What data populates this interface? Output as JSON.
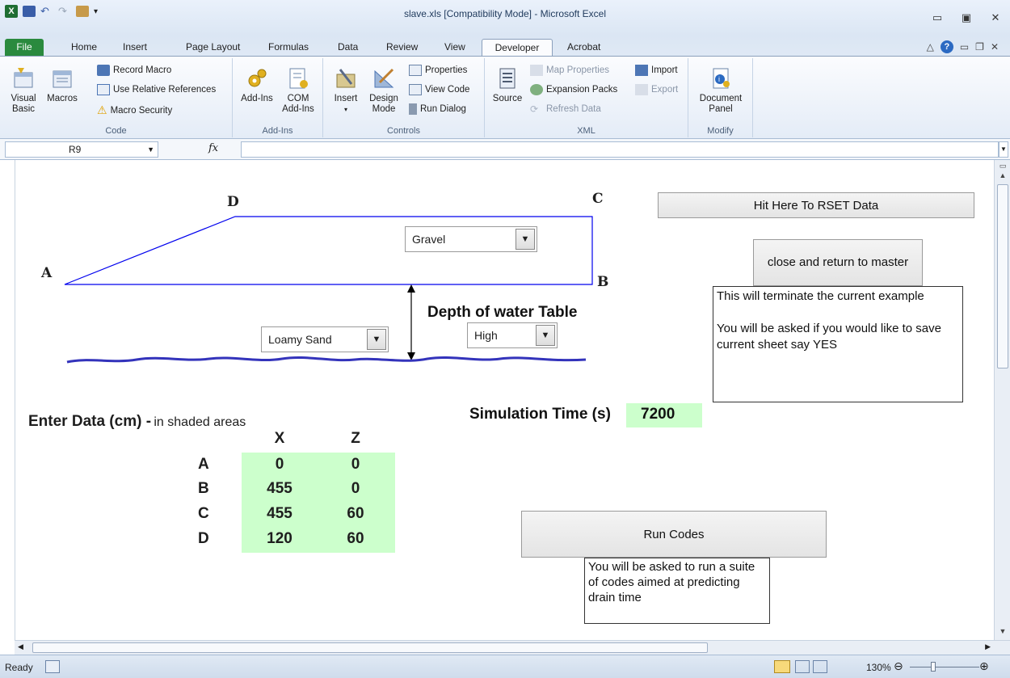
{
  "window": {
    "title": "slave.xls  [Compatibility Mode]  -  Microsoft Excel"
  },
  "tabs": [
    "File",
    "Home",
    "Insert",
    "Page Layout",
    "Formulas",
    "Data",
    "Review",
    "View",
    "Developer",
    "Acrobat"
  ],
  "ribbon": {
    "code": {
      "label": "Code",
      "visual_basic": "Visual Basic",
      "macros": "Macros",
      "record_macro": "Record Macro",
      "use_relative": "Use Relative References",
      "macro_security": "Macro Security"
    },
    "addins": {
      "label": "Add-Ins",
      "addins": "Add-Ins",
      "com_addins": "COM Add-Ins"
    },
    "controls": {
      "label": "Controls",
      "insert": "Insert",
      "design_mode": "Design Mode",
      "properties": "Properties",
      "view_code": "View Code",
      "run_dialog": "Run Dialog"
    },
    "xml": {
      "label": "XML",
      "source": "Source",
      "map_properties": "Map Properties",
      "expansion_packs": "Expansion Packs",
      "refresh_data": "Refresh Data",
      "import": "Import",
      "export": "Export"
    },
    "modify": {
      "label": "Modify",
      "document_panel": "Document Panel"
    }
  },
  "formula_bar": {
    "name_box": "R9",
    "fx": "fx",
    "formula": ""
  },
  "sheet": {
    "point_labels": {
      "A": "A",
      "B": "B",
      "C": "C",
      "D": "D"
    },
    "combo_gravel": "Gravel",
    "combo_loamy_sand": "Loamy Sand",
    "combo_water_level": "High",
    "depth_label": "Depth of water Table",
    "reset_button": "Hit Here To RSET Data",
    "close_button": "close and return to master",
    "close_note_1": "This will terminate the current example",
    "close_note_2": "You will be asked if you would like to save current sheet say YES",
    "sim_time_label": "Simulation Time (s)",
    "sim_time_value": "7200",
    "enter_data_bold": "Enter Data (cm) -",
    "enter_data_normal": "in shaded areas",
    "run_button": "Run Codes",
    "run_note": "You will be asked to run a suite of codes aimed at predicting drain time",
    "table": {
      "headers": [
        "X",
        "Z"
      ],
      "rows": [
        {
          "label": "A",
          "x": "0",
          "z": "0"
        },
        {
          "label": "B",
          "x": "455",
          "z": "0"
        },
        {
          "label": "C",
          "x": "455",
          "z": "60"
        },
        {
          "label": "D",
          "x": "120",
          "z": "60"
        }
      ]
    }
  },
  "status": {
    "ready": "Ready",
    "zoom": "130%"
  },
  "colors": {
    "shaded_cells": "#ccffcc",
    "shape_outline": "#0000ee",
    "water_line": "#3333bb"
  }
}
